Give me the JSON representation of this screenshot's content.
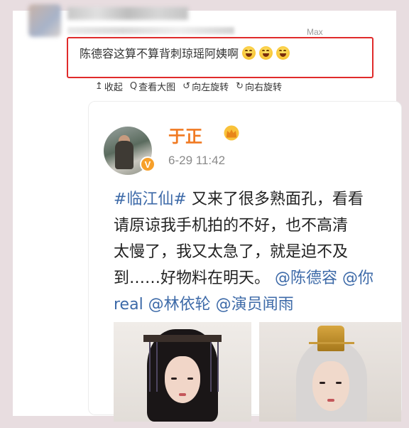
{
  "header": {
    "device_label": "Max"
  },
  "comment": {
    "text": "陈德容这算不算背刺琼瑶阿姨啊",
    "emojis": [
      "laughing-emoji",
      "laughing-emoji",
      "laughing-emoji"
    ],
    "highlight_color": "#e02b2b"
  },
  "toolbar": {
    "items": [
      {
        "icon": "↥",
        "label": "收起"
      },
      {
        "icon": "Q",
        "label": "查看大图"
      },
      {
        "icon": "↺",
        "label": "向左旋转"
      },
      {
        "icon": "↻",
        "label": "向右旋转"
      }
    ]
  },
  "post": {
    "username": "于正",
    "badge": "V",
    "time": "6-29 11:42",
    "lines": [
      {
        "segments": [
          {
            "text": "#临江仙#",
            "link": true
          },
          {
            "text": " 又来了很多熟面孔，看看",
            "link": false
          }
        ]
      },
      {
        "segments": [
          {
            "text": "请原谅我手机拍的不好，也不高清",
            "link": false
          }
        ]
      },
      {
        "segments": [
          {
            "text": "太慢了，我又太急了，就是迫不及",
            "link": false
          }
        ]
      },
      {
        "segments": [
          {
            "text": "到……好物料在明天。",
            "link": false
          },
          {
            "text": " @陈德容 @你",
            "link": true
          }
        ]
      },
      {
        "segments": [
          {
            "text": "real @林依轮 @演员闻雨",
            "link": true
          }
        ]
      }
    ],
    "colors": {
      "username": "#f07a23",
      "link": "#3d6aa8"
    }
  }
}
